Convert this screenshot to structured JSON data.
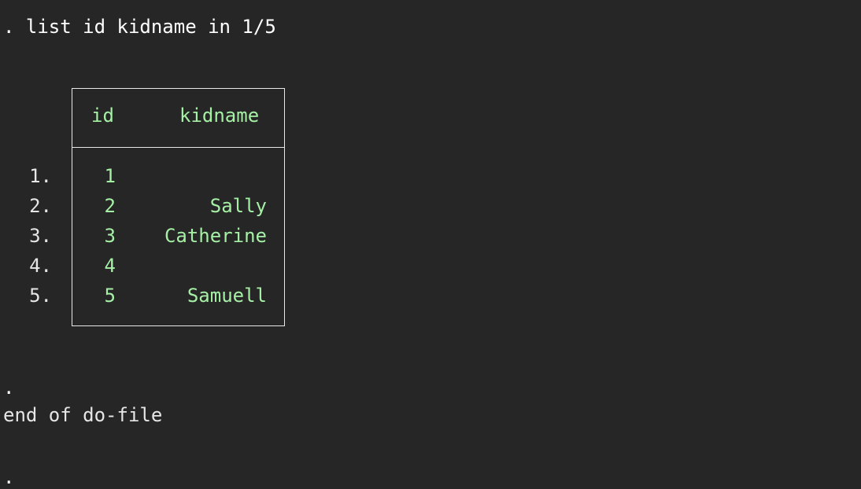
{
  "console": {
    "command": ". list id kidname in 1/5",
    "prompt_dot": ".",
    "end_message": "end of do-file",
    "final_prompt": "."
  },
  "table": {
    "headers": {
      "id": "id",
      "kidname": "kidname"
    },
    "rows": [
      {
        "num": "1.",
        "id": "1",
        "kidname": ""
      },
      {
        "num": "2.",
        "id": "2",
        "kidname": "Sally"
      },
      {
        "num": "3.",
        "id": "3",
        "kidname": "Catherine"
      },
      {
        "num": "4.",
        "id": "4",
        "kidname": ""
      },
      {
        "num": "5.",
        "id": "5",
        "kidname": "Samuell"
      }
    ]
  },
  "colors": {
    "background": "#262626",
    "text": "#ffffff",
    "value_text": "#a6f0a6",
    "border": "#e8e8e8"
  }
}
